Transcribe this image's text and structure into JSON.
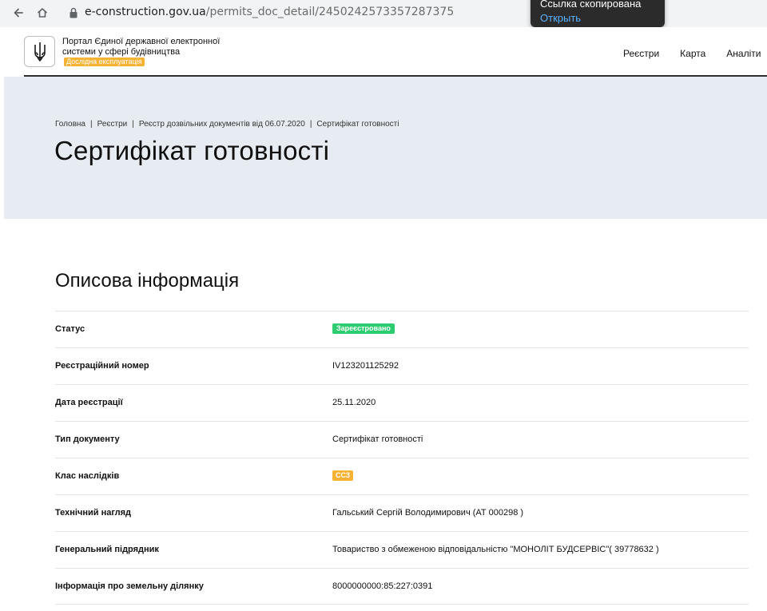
{
  "browser": {
    "url_domain": "e-construction.gov.ua",
    "url_path": "/permits_doc_detail/2450242573357287375"
  },
  "toast": {
    "title": "Ссылка скопирована",
    "action": "Открыть"
  },
  "header": {
    "portal_title": "Портал Єдиної державної електронної системи у сфері будівництва",
    "beta_badge": "Дослідна експлуатація",
    "nav": [
      "Реєстри",
      "Карта",
      "Аналіти"
    ]
  },
  "breadcrumb": [
    "Головна",
    "Реєстри",
    "Реєстр дозвільних документів від 06.07.2020",
    "Сертифікат готовності"
  ],
  "page_title": "Сертифікат готовності",
  "section_title": "Описова інформація",
  "rows": [
    {
      "label": "Статус",
      "value": "Зареєстровано"
    },
    {
      "label": "Реєстраційний номер",
      "value": "IV123201125292"
    },
    {
      "label": "Дата реєстрації",
      "value": "25.11.2020"
    },
    {
      "label": "Тип документу",
      "value": "Сертифікат готовності"
    },
    {
      "label": "Клас наслідків",
      "value": "СС3"
    },
    {
      "label": "Технічний нагляд",
      "value": "Гальський Сергій Володимирович (АТ 000298 )"
    },
    {
      "label": "Генеральний підрядник",
      "value": "Товариство з обмеженою відповідальністю \"МОНОЛІТ БУДСЕРВІС\"( 39778632 )"
    },
    {
      "label": "Інформація про земельну ділянку",
      "value": "8000000000:85:227:0391"
    }
  ],
  "colors": {
    "status_green": "#2ecc71",
    "badge_orange": "#f6b233",
    "hero_bg": "#e6ecf1"
  }
}
